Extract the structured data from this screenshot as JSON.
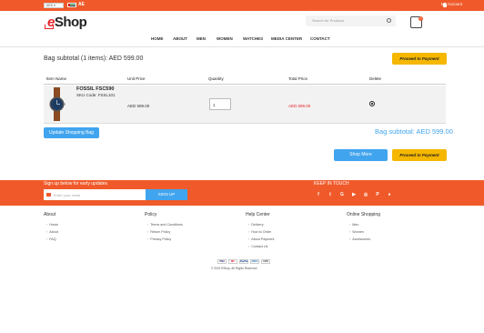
{
  "topbar": {
    "currency": "AED ▾",
    "country_code": "AE",
    "account": "My Account",
    "flag_colors": {
      "red": "#c00000",
      "green": "#00732f",
      "black": "#000000"
    }
  },
  "logo": {
    "e": "e",
    "shop": "Shop"
  },
  "search": {
    "placeholder": "Search for Products"
  },
  "cart": {
    "count": "0"
  },
  "nav": [
    "HOME",
    "ABOUT",
    "MEN",
    "WOMEN",
    "WATCHES",
    "MEDIA CENTER",
    "CONTACT"
  ],
  "bag": {
    "subtotal_heading": "Bag subtotal (1 items): AED 599.00",
    "proceed_label": "Proceed to Payment",
    "columns": [
      "Item Name",
      "Unit Price",
      "Quantity",
      "Total Price",
      "Delete"
    ],
    "item": {
      "name": "FOSSIL FSC590",
      "sku": "SKU Code: FSSL101",
      "unit_price": "AED 599.00",
      "quantity": "1",
      "total_price": "AED 599.00"
    },
    "update_label": "Update Shopping Bag",
    "subtotal_bottom": "Bag subtotal: AED 599.00",
    "shop_more_label": "Shop More"
  },
  "footer": {
    "signup_text": "Sign up below for early updates",
    "email_placeholder": "Enter your email",
    "signup_button": "SIGN UP",
    "keep_in_touch": "KEEP IN TOUCH",
    "social_icons": [
      "facebook-icon",
      "twitter-icon",
      "google-plus-icon",
      "youtube-icon",
      "instagram-icon",
      "pinterest-icon",
      "snapchat-icon"
    ],
    "columns": [
      {
        "heading": "About",
        "links": [
          "Home",
          "About",
          "FAQ"
        ]
      },
      {
        "heading": "Policy",
        "links": [
          "Terms and Conditions",
          "Return Policy",
          "Privacy Policy"
        ]
      },
      {
        "heading": "Help Center",
        "links": [
          "Delivery",
          "How to Order",
          "About Payment",
          "Contact Us"
        ]
      },
      {
        "heading": "Online Shopping",
        "links": [
          "Men",
          "Women",
          "Accessories"
        ]
      }
    ],
    "payments": [
      "VISA",
      "MC",
      "PayPal",
      "AMEX",
      "COD"
    ],
    "copyright": "© 2019 EShop. All Rights Reserved"
  },
  "colors": {
    "accent": "#f05a2a",
    "blue": "#41a4ee",
    "orange_button": "#f5b700"
  }
}
